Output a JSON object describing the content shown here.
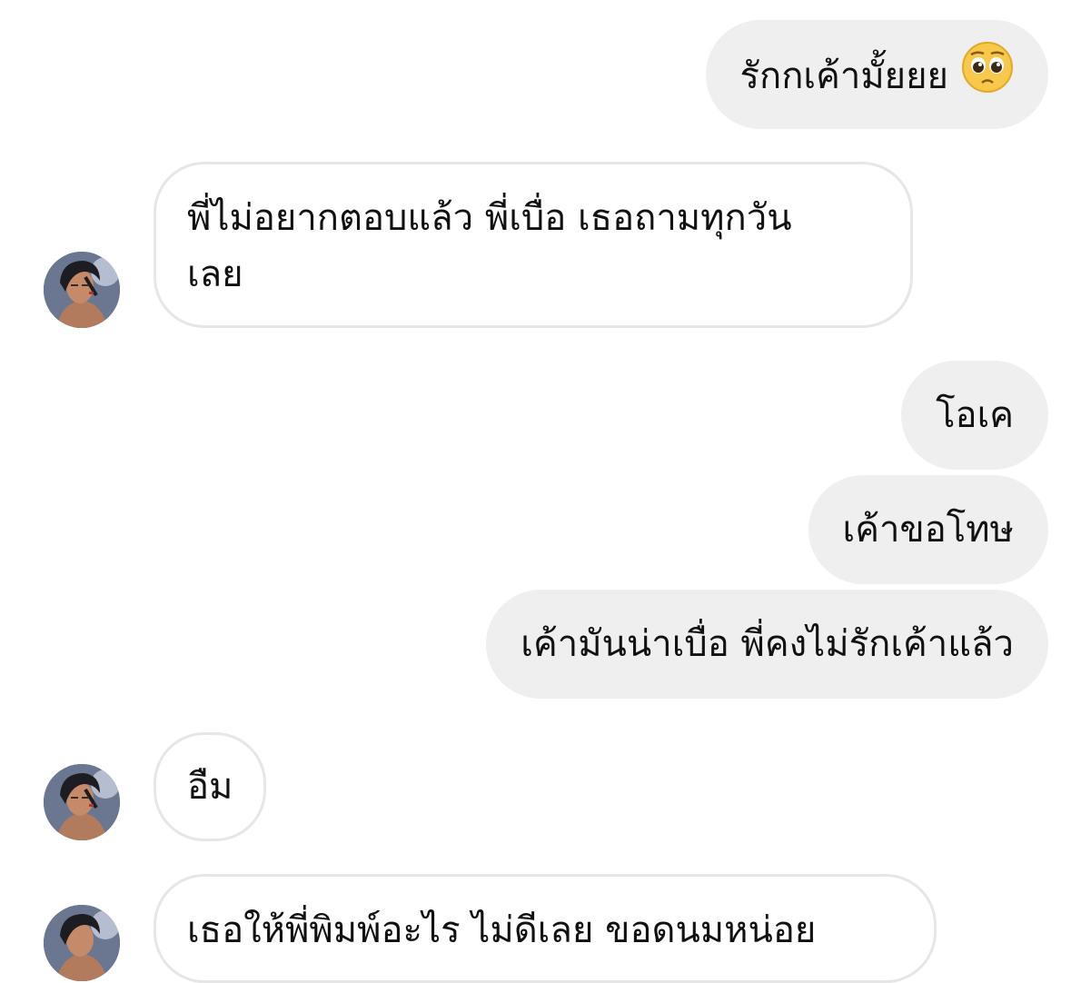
{
  "messages": [
    {
      "id": "m1",
      "side": "outgoing",
      "text": "รักกเค้ามั้ยยย",
      "emoji": "pleading-face-emoji"
    },
    {
      "id": "m2",
      "side": "incoming",
      "line1": "พี่ไม่อยากตอบแล้ว พี่เบื่อ เธอถามทุกวัน",
      "line2": "เลย"
    },
    {
      "id": "m3",
      "side": "outgoing",
      "text": "โอเค"
    },
    {
      "id": "m4",
      "side": "outgoing",
      "text": "เค้าขอโทษ"
    },
    {
      "id": "m5",
      "side": "outgoing",
      "text": "เค้ามันน่าเบื่อ พี่คงไม่รักเค้าแล้ว"
    },
    {
      "id": "m6",
      "side": "incoming",
      "text": "อืม"
    },
    {
      "id": "m7",
      "side": "incoming",
      "text": "เธอให้พี่พิมพ์อะไร ไม่ดีเลย ขอดนมหน่อย"
    }
  ],
  "colors": {
    "outgoing_bubble": "#efefef",
    "incoming_border": "#e6e6e6",
    "text": "#111111"
  },
  "icons": {
    "avatar": "contact-avatar",
    "emoji": "pleading-face-emoji"
  }
}
